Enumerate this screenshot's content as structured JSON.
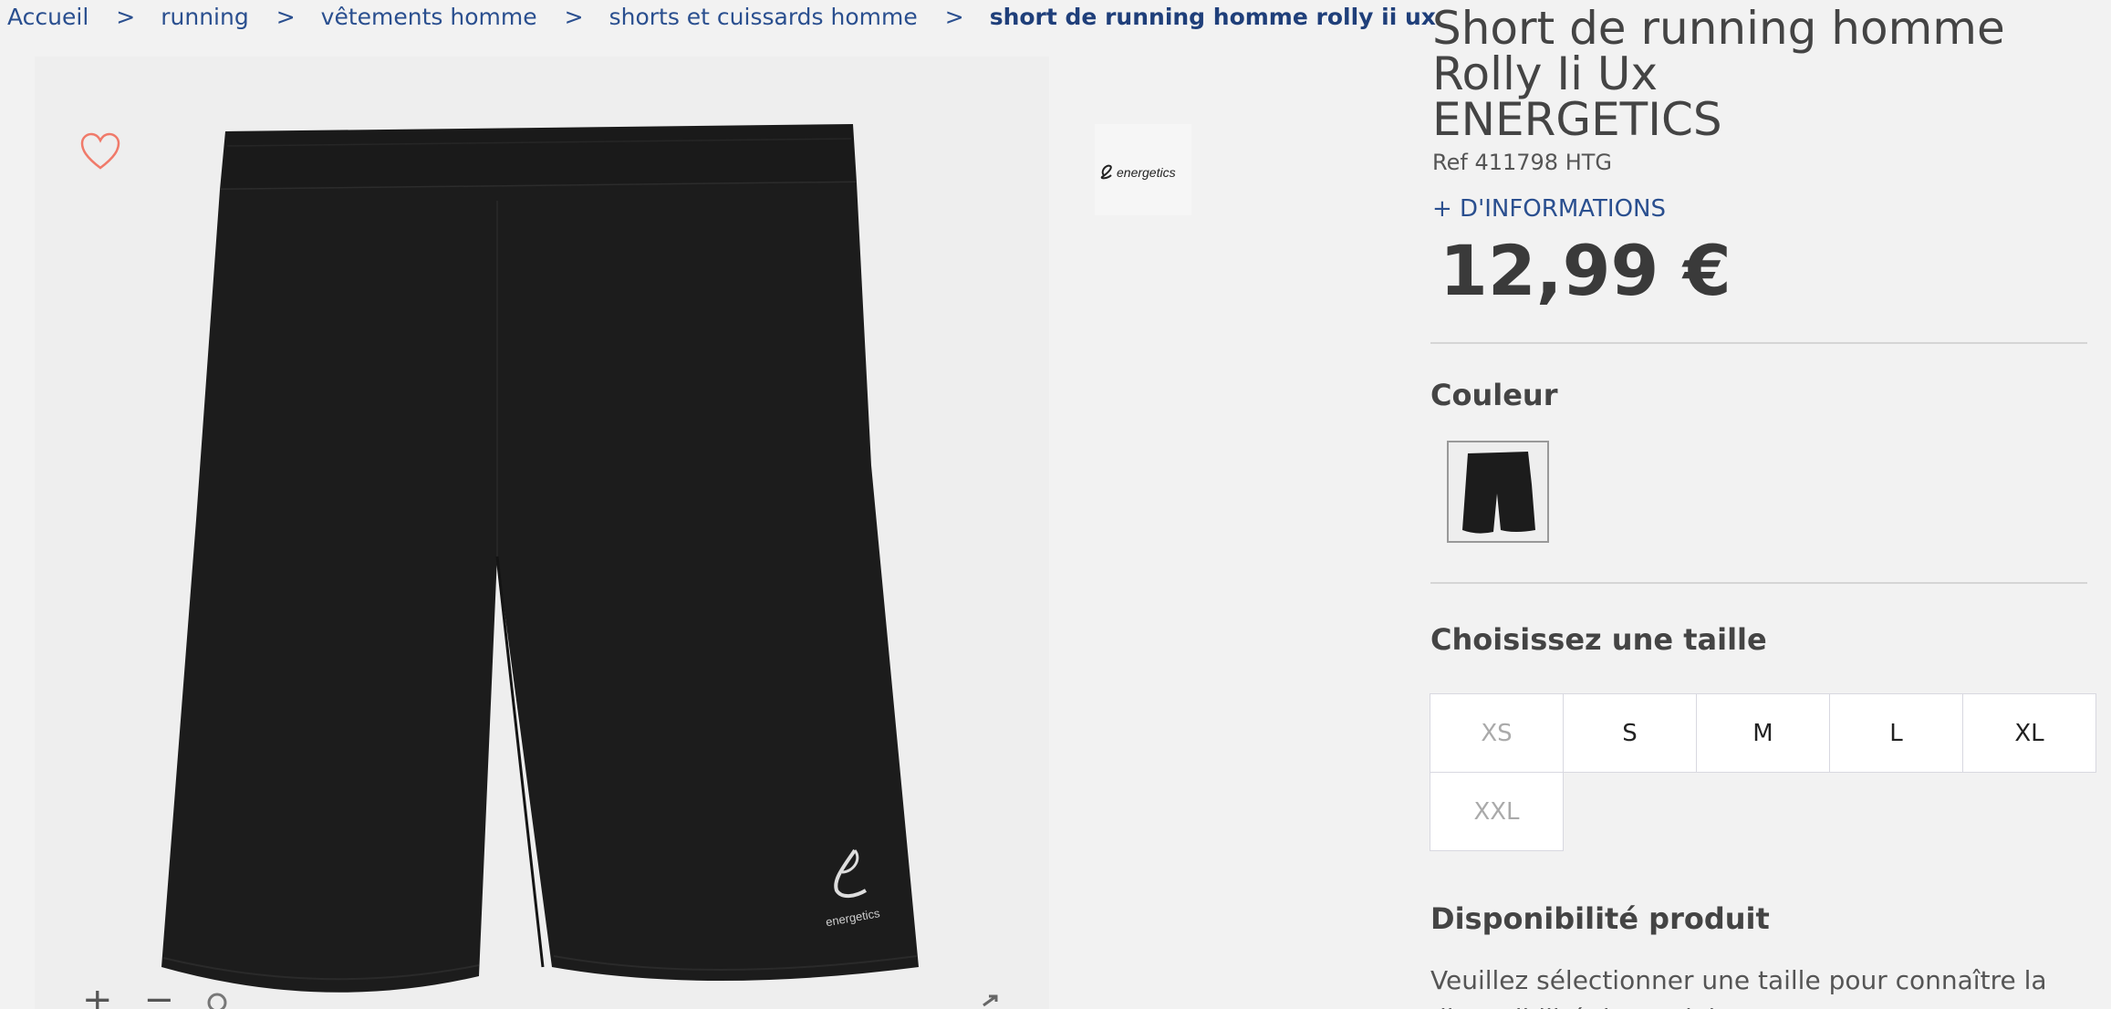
{
  "breadcrumb": {
    "items": [
      "Accueil",
      "running",
      "vêtements homme",
      "shorts et cuissards homme"
    ],
    "current": "short de running homme rolly ii ux",
    "separator": ">"
  },
  "product": {
    "title_line": "Short de running homme Rolly Ii Ux",
    "brand": "ENERGETICS",
    "ref": "Ref 411798 HTG",
    "more_info": "+ D'INFORMATIONS",
    "price": "12,99 €",
    "logo_text": "energetics"
  },
  "color": {
    "title": "Couleur"
  },
  "size": {
    "title": "Choisissez une taille",
    "options": [
      {
        "label": "XS",
        "available": false
      },
      {
        "label": "S",
        "available": true
      },
      {
        "label": "M",
        "available": true
      },
      {
        "label": "L",
        "available": true
      },
      {
        "label": "XL",
        "available": true
      },
      {
        "label": "XXL",
        "available": false
      }
    ]
  },
  "availability": {
    "title": "Disponibilité produit",
    "text": "Veuillez sélectionner une taille pour connaître la disponibilité du produit"
  },
  "image_tools": {
    "zoom_in": "+",
    "zoom_out": "−"
  },
  "colors": {
    "link": "#2a4f8f",
    "wishlist": "#f07a6a",
    "product": "#1c1c1c"
  }
}
